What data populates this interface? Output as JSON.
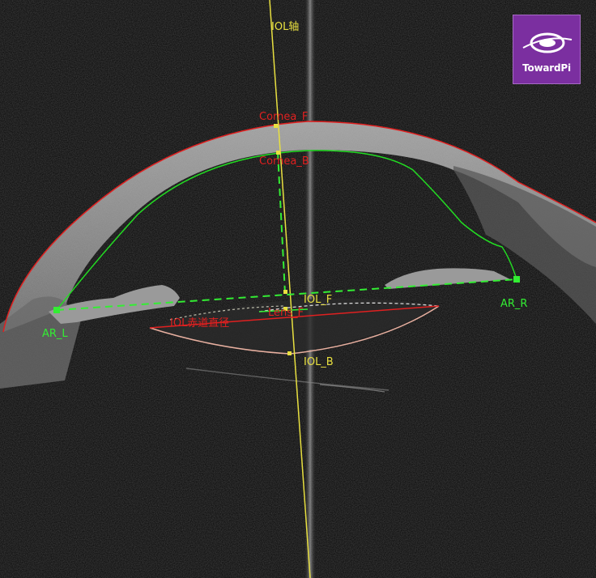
{
  "brand": {
    "logo_text": "TowardPi"
  },
  "labels": {
    "iol_axis": "IOL轴",
    "cornea_f": "Cornea_F",
    "cornea_b": "Cornea_B",
    "iol_f": "IOL_F",
    "iol_b": "IOL_B",
    "lens_f": "Lens_F",
    "iol_diameter": "IOL赤道直径",
    "ar_l": "AR_L",
    "ar_r": "AR_R"
  },
  "colors": {
    "axis_line": "#e8e040",
    "cornea_front_curve": "#e02020",
    "cornea_back_curve": "#22dd22",
    "measurement_green": "#33ee33",
    "label_red": "#e02020",
    "label_yellow": "#e8e040",
    "label_green": "#33ee33",
    "brand_purple": "#7b2fa0"
  }
}
